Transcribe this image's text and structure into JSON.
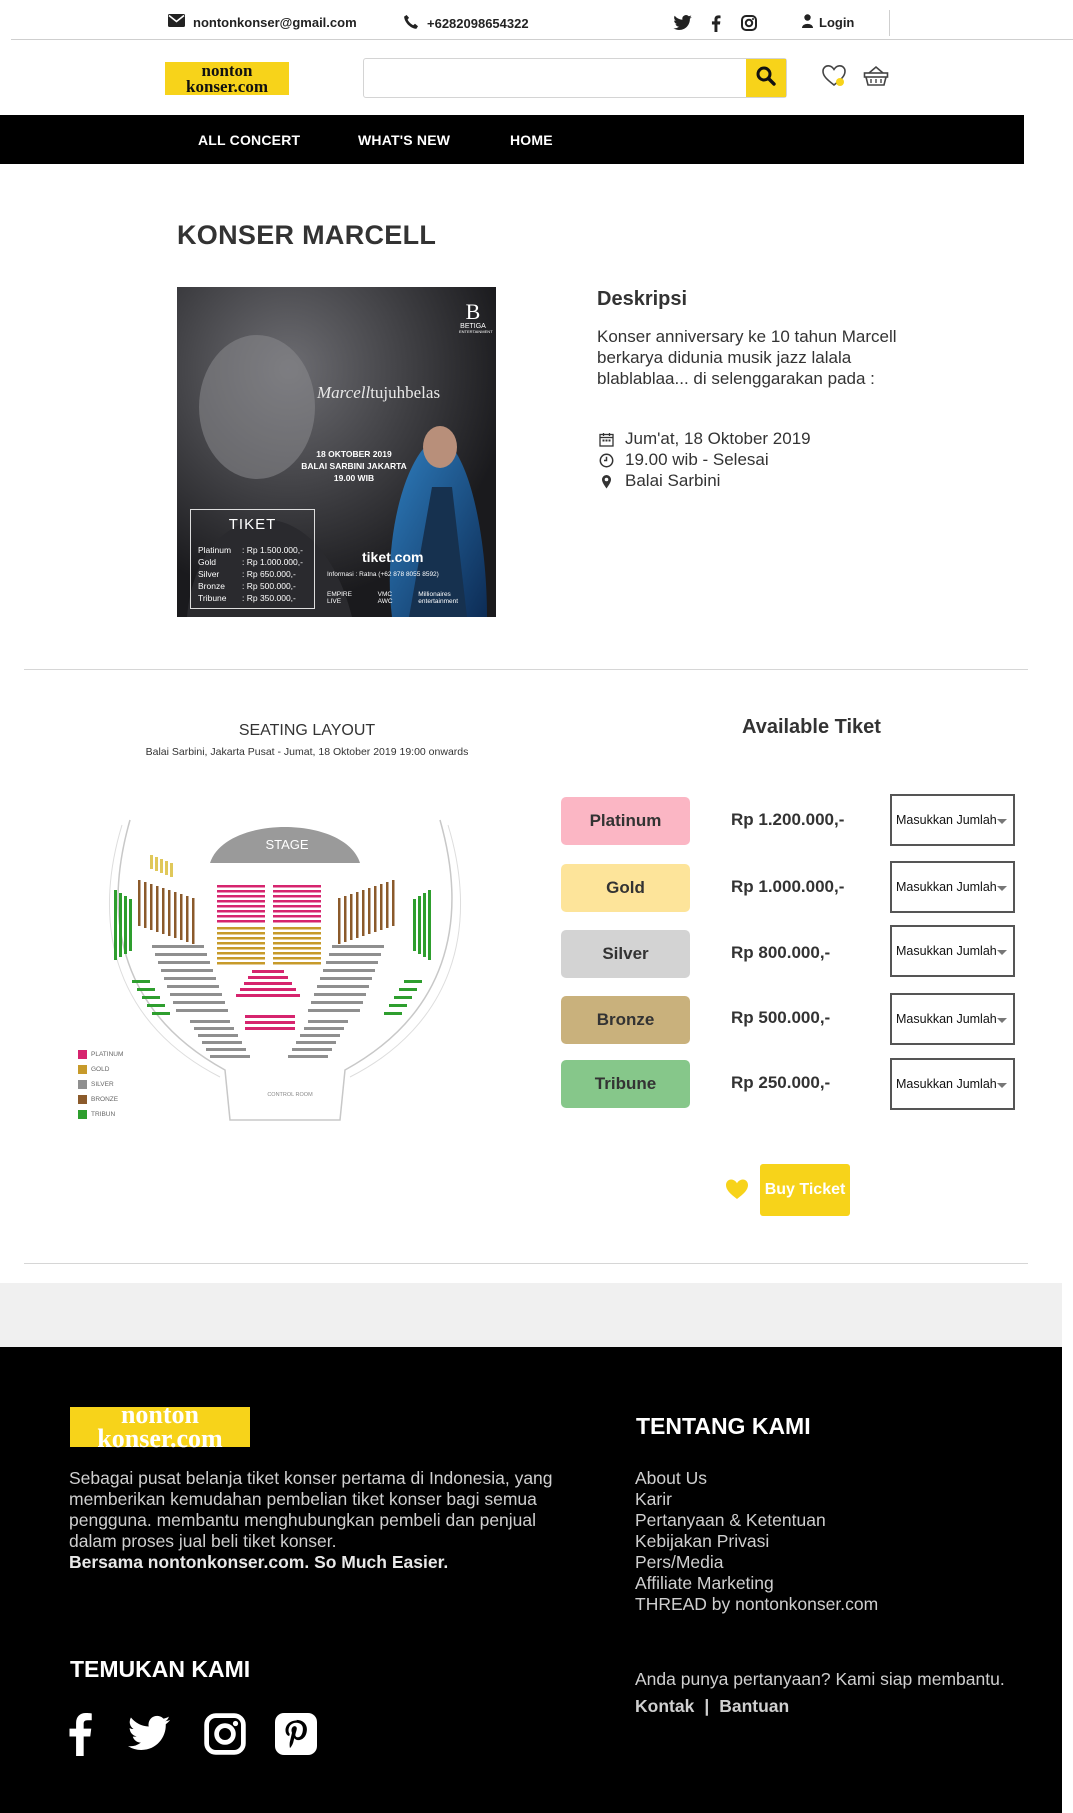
{
  "topbar": {
    "email": "nontonkonser@gmail.com",
    "phone": "+6282098654322",
    "login": "Login",
    "social_icons": [
      "twitter-icon",
      "facebook-icon",
      "instagram-icon"
    ]
  },
  "header": {
    "logo_line1": "nonton",
    "logo_line2": "konser.com",
    "search_placeholder": "",
    "search_value": "",
    "accent_color": "#f7d31a"
  },
  "nav": {
    "items": [
      "ALL CONCERT",
      "WHAT'S NEW",
      "HOME"
    ]
  },
  "event": {
    "title": "KONSER MARCELL",
    "poster": {
      "brand": "BETIGA",
      "brand_sub": "ENTERTAINMENT",
      "headline_script": "Marcell",
      "headline_rest": "tujuhbelas",
      "date": "18 OKTOBER 2019",
      "venue": "BALAI SARBINI JAKARTA",
      "time": "19.00 WIB",
      "ticket_title": "TIKET",
      "ticket_rows": [
        {
          "tier": "Platinum",
          "price": ": Rp 1.500.000,-"
        },
        {
          "tier": "Gold",
          "price": ": Rp 1.000.000,-"
        },
        {
          "tier": "Silver",
          "price": ": Rp 650.000,-"
        },
        {
          "tier": "Bronze",
          "price": ": Rp 500.000,-"
        },
        {
          "tier": "Tribune",
          "price": ": Rp 350.000,-"
        }
      ],
      "partner": "tiket.com",
      "info": "Informasi : Ratna (+62 878 8055 8592)",
      "sponsors": [
        "EMPIRE LIVE",
        "VMC AWC",
        "Millionaires entertainment"
      ]
    },
    "desc_heading": "Deskripsi",
    "desc_text": "Konser anniversary ke 10 tahun Marcell berkarya didunia musik jazz lalala blablablaa... di selenggarakan pada :",
    "date": "Jum'at, 18 Oktober 2019",
    "time": "19.00 wib - Selesai",
    "venue": "Balai Sarbini"
  },
  "seating": {
    "title": "SEATING LAYOUT",
    "subtitle": "Balai Sarbini, Jakarta Pusat - Jumat, 18 Oktober 2019 19:00 onwards",
    "stage": "STAGE",
    "control_room": "CONTROL ROOM",
    "legend": [
      {
        "label": "PLATINUM",
        "color": "#d6246e"
      },
      {
        "label": "GOLD",
        "color": "#c79a2a"
      },
      {
        "label": "SILVER",
        "color": "#8f8f8f"
      },
      {
        "label": "BRONZE",
        "color": "#8b5a2b"
      },
      {
        "label": "TRIBUN",
        "color": "#2e9e2e"
      }
    ]
  },
  "tickets": {
    "title": "Available Tiket",
    "items": [
      {
        "tier": "Platinum",
        "price": "Rp 1.200.000,-",
        "color": "#fbb6c4"
      },
      {
        "tier": "Gold",
        "price": "Rp 1.000.000,-",
        "color": "#fde49a"
      },
      {
        "tier": "Silver",
        "price": "Rp 800.000,-",
        "color": "#d3d3d3"
      },
      {
        "tier": "Bronze",
        "price": "Rp 500.000,-",
        "color": "#c9b17c"
      },
      {
        "tier": "Tribune",
        "price": "Rp 250.000,-",
        "color": "#86c78a"
      }
    ],
    "qty_placeholder": "Masukkan Jumlah",
    "buy_label": "Buy Ticket"
  },
  "footer": {
    "logo_line1": "nonton",
    "logo_line2": "konser.com",
    "about_text": "Sebagai pusat belanja tiket konser pertama di Indonesia, yang memberikan kemudahan pembelian tiket konser bagi semua pengguna. membantu menghubungkan pembeli dan penjual dalam proses jual beli tiket konser.",
    "about_tagline": "Bersama nontonkonser.com. So Much Easier.",
    "tentang_heading": "TENTANG KAMI",
    "links": [
      "About Us",
      "Karir",
      "Pertanyaan & Ketentuan",
      "Kebijakan Privasi",
      "Pers/Media",
      "Affiliate Marketing",
      "THREAD by nontonkonser.com"
    ],
    "temukan_heading": "TEMUKAN KAMI",
    "social_icons": [
      "facebook-icon",
      "twitter-icon",
      "instagram-icon",
      "pinterest-icon"
    ],
    "question": "Anda punya pertanyaan? Kami siap membantu.",
    "contact": "Kontak",
    "separator": "|",
    "help": "Bantuan"
  }
}
